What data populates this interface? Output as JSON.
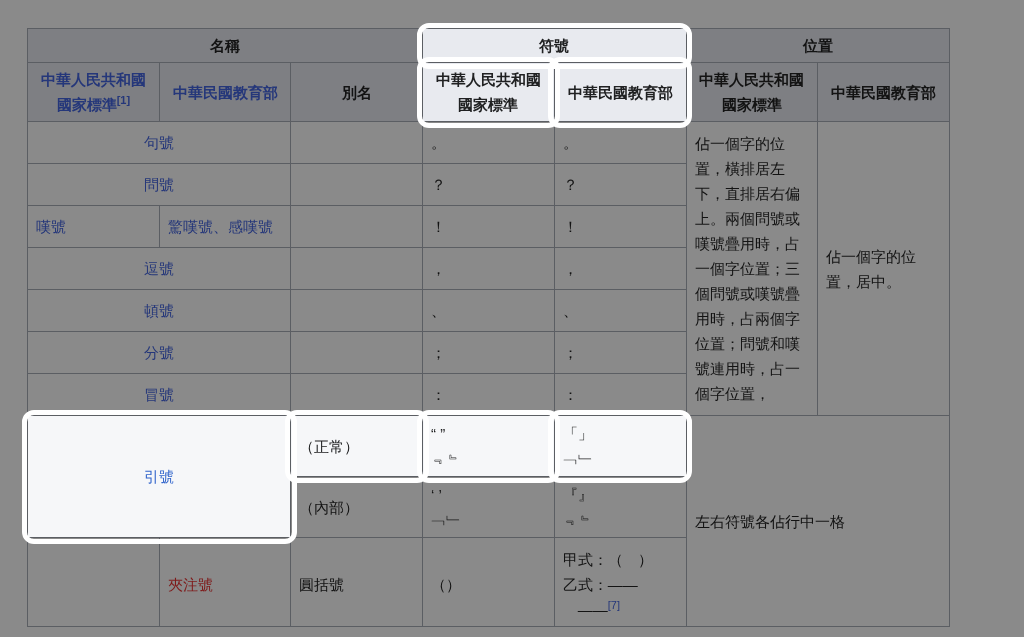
{
  "table": {
    "header_rows": [
      [
        {
          "text": "名稱",
          "colspan": 3,
          "highlighted": false
        },
        {
          "text": "符號",
          "colspan": 2,
          "highlighted": true
        },
        {
          "text": "位置",
          "colspan": 2,
          "highlighted": false
        }
      ],
      [
        {
          "text": "中華人民共和國國家標準$^{[1]}$",
          "kind": "link",
          "highlighted": false
        },
        {
          "text": "中華民國教育部",
          "kind": "link",
          "highlighted": false
        },
        {
          "text": "別名",
          "kind": "text",
          "highlighted": false
        },
        {
          "text": "中華人民共和國國家標準",
          "kind": "text",
          "highlighted": true
        },
        {
          "text": "中華民國教育部",
          "kind": "text",
          "highlighted": true
        },
        {
          "text": "中華人民共和國國家標準",
          "kind": "text",
          "highlighted": false
        },
        {
          "text": "中華民國教育部",
          "kind": "text",
          "highlighted": false
        }
      ]
    ],
    "rows": [
      [
        {
          "lines": [
            "句號"
          ],
          "kind": "link",
          "colspan": 2,
          "highlighted": false
        },
        {
          "highlighted": false
        },
        {
          "lines": [
            "。"
          ],
          "kind": "text",
          "highlighted": false
        },
        {
          "lines": [
            "。"
          ],
          "kind": "text",
          "highlighted": false
        },
        {
          "lines": [
            "佔一個字的位置，橫排居左下，直排居右偏上。兩個問號或嘆號疊用時，占一個字位置；三個問號或嘆號疊用時，占兩個字位置；問號和嘆號連用時，占一個字位置，"
          ],
          "kind": "text",
          "rowspan": 7,
          "highlighted": false
        },
        {
          "lines": [
            "佔一個字的位置，居中。"
          ],
          "kind": "text",
          "rowspan": 7,
          "highlighted": false
        }
      ],
      [
        {
          "lines": [
            "問號"
          ],
          "kind": "link",
          "colspan": 2,
          "highlighted": false
        },
        {
          "highlighted": false
        },
        {
          "lines": [
            "？"
          ],
          "kind": "text",
          "highlighted": false
        },
        {
          "lines": [
            "？"
          ],
          "kind": "text",
          "highlighted": false
        }
      ],
      [
        {
          "lines": [
            "嘆號"
          ],
          "kind": "link",
          "highlighted": false
        },
        {
          "lines": [
            "驚嘆號、感嘆號"
          ],
          "kind": "link",
          "highlighted": false
        },
        {
          "highlighted": false
        },
        {
          "lines": [
            "！"
          ],
          "kind": "text",
          "highlighted": false
        },
        {
          "lines": [
            "！"
          ],
          "kind": "text",
          "highlighted": false
        }
      ],
      [
        {
          "lines": [
            "逗號"
          ],
          "kind": "link",
          "colspan": 2,
          "highlighted": false
        },
        {
          "highlighted": false
        },
        {
          "lines": [
            "，"
          ],
          "kind": "text",
          "highlighted": false
        },
        {
          "lines": [
            "，"
          ],
          "kind": "text",
          "highlighted": false
        }
      ],
      [
        {
          "lines": [
            "頓號"
          ],
          "kind": "link",
          "colspan": 2,
          "highlighted": false
        },
        {
          "highlighted": false
        },
        {
          "lines": [
            "、"
          ],
          "kind": "text",
          "highlighted": false
        },
        {
          "lines": [
            "、"
          ],
          "kind": "text",
          "highlighted": false
        }
      ],
      [
        {
          "lines": [
            "分號"
          ],
          "kind": "link",
          "colspan": 2,
          "highlighted": false
        },
        {
          "highlighted": false
        },
        {
          "lines": [
            "；"
          ],
          "kind": "text",
          "highlighted": false
        },
        {
          "lines": [
            "；"
          ],
          "kind": "text",
          "highlighted": false
        }
      ],
      [
        {
          "lines": [
            "冒號"
          ],
          "kind": "link",
          "colspan": 2,
          "highlighted": false
        },
        {
          "highlighted": false
        },
        {
          "lines": [
            "："
          ],
          "kind": "text",
          "highlighted": false
        },
        {
          "lines": [
            "："
          ],
          "kind": "text",
          "highlighted": false
        }
      ],
      [
        {
          "lines": [
            "引號"
          ],
          "kind": "link",
          "colspan": 2,
          "rowspan": 2,
          "highlighted": true
        },
        {
          "lines": [
            "（正常）"
          ],
          "kind": "text",
          "highlighted": true
        },
        {
          "lines": [
            "“ ”",
            "﹃﹄"
          ],
          "kind": "text",
          "highlighted": true
        },
        {
          "lines": [
            "「」",
            "﹁﹂"
          ],
          "kind": "text",
          "highlighted": true
        },
        {
          "lines": [
            "左右符號各佔行中一格"
          ],
          "kind": "text",
          "colspan": 2,
          "rowspan": 3,
          "highlighted": false
        }
      ],
      [
        {
          "lines": [
            "（內部）"
          ],
          "kind": "text",
          "highlighted": false
        },
        {
          "lines": [
            "‘ ’",
            "﹁﹂"
          ],
          "kind": "text",
          "highlighted": false
        },
        {
          "lines": [
            "『』",
            "﹃﹄"
          ],
          "kind": "text",
          "highlighted": false
        }
      ],
      [
        {
          "highlighted": false
        },
        {
          "lines": [
            "夾注號"
          ],
          "kind": "redlink",
          "highlighted": false
        },
        {
          "lines": [
            "圓括號"
          ],
          "kind": "text",
          "highlighted": false
        },
        {
          "lines": [
            "（）"
          ],
          "kind": "text",
          "highlighted": false
        },
        {
          "lines": [
            "甲式：（　）",
            "乙式：——",
            "　——$^{[7]}$"
          ],
          "kind": "text",
          "highlighted": false
        }
      ]
    ]
  }
}
